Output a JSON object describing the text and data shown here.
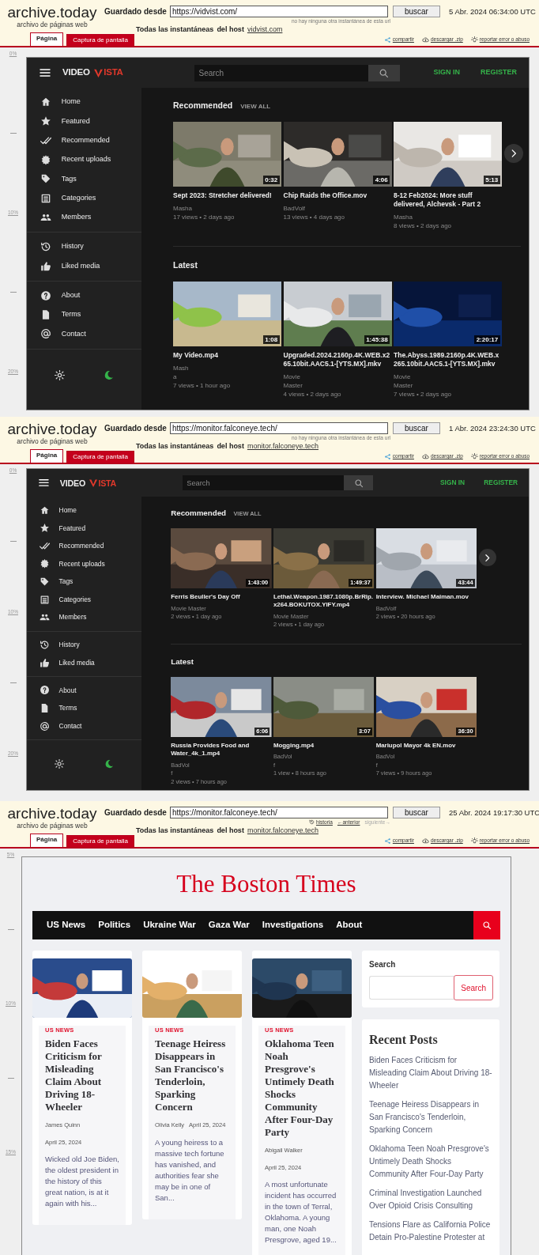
{
  "snapshots": [
    {
      "archive": {
        "logo": "archive.today",
        "tagline": "archivo de páginas web",
        "saved_from_label": "Guardado desde",
        "url": "https://vidvist.com/",
        "search_button": "buscar",
        "date": "5 Abr. 2024 06:34:00 UTC",
        "note": "no hay ninguna otra instantánea de esta url",
        "all_snapshots_label": "Todas las instantáneas",
        "host_label": "del host",
        "host": "vidvist.com",
        "tabs": [
          {
            "label": "Página",
            "selected": true
          },
          {
            "label": "Captura de pantalla",
            "selected": false
          }
        ],
        "actions": [
          {
            "kind": "share",
            "label": "compartir"
          },
          {
            "kind": "download",
            "label": "descargar .zip"
          },
          {
            "kind": "report",
            "label": "reportar error o abuso"
          }
        ],
        "ruler": [
          "0%",
          "10%",
          "20%"
        ]
      },
      "site": {
        "kind": "video",
        "logo": {
          "text": "VIDEO",
          "accent": "ISTA"
        },
        "search_placeholder": "Search",
        "auth": [
          "SIGN IN",
          "REGISTER"
        ],
        "nav_groups": [
          [
            "Home",
            "Featured",
            "Recommended",
            "Recent uploads",
            "Tags",
            "Categories",
            "Members"
          ],
          [
            "History",
            "Liked media"
          ],
          [
            "About",
            "Terms",
            "Contact"
          ]
        ],
        "theme_options": [
          {
            "kind": "light",
            "selected": false
          },
          {
            "kind": "dark",
            "selected": true
          }
        ],
        "sections": [
          {
            "title": "Recommended",
            "link": "VIEW ALL",
            "videos": [
              {
                "duration": "0:32",
                "title": "Sept 2023: Stretcher delivered!",
                "author_lines": [
                  "Masha"
                ],
                "meta": "17 views • 2 days ago"
              },
              {
                "duration": "4:06",
                "title": "Chip Raids the Office.mov",
                "author_lines": [
                  "BadVolf"
                ],
                "meta": "13 views • 4 days ago"
              },
              {
                "duration": "5:13",
                "title": "8-12 Feb2024: More stuff delivered, Alchevsk - Part 2",
                "author_lines": [
                  "Masha"
                ],
                "meta": "8 views • 2 days ago"
              }
            ]
          },
          {
            "title": "Latest",
            "videos": [
              {
                "duration": "1:08",
                "title": "My Video.mp4",
                "author_lines": [
                  "Mash",
                  "a"
                ],
                "meta": "7 views • 1 hour ago"
              },
              {
                "duration": "1:45:38",
                "title": "Upgraded.2024.2160p.4K.WEB.x265.10bit.AAC5.1-[YTS.MX].mkv",
                "author_lines": [
                  "Movie",
                  "Master"
                ],
                "meta": "4 views • 2 days ago"
              },
              {
                "duration": "2:20:17",
                "title": "The.Abyss.1989.2160p.4K.WEB.x265.10bit.AAC5.1-[YTS.MX].mkv",
                "author_lines": [
                  "Movie",
                  "Master"
                ],
                "meta": "7 views • 2 days ago"
              }
            ]
          }
        ]
      }
    },
    {
      "archive": {
        "logo": "archive.today",
        "tagline": "archivo de páginas web",
        "saved_from_label": "Guardado desde",
        "url": "https://monitor.falconeye.tech/",
        "search_button": "buscar",
        "date": "1 Abr. 2024 23:24:30 UTC",
        "note": "no hay ninguna otra instantánea de esta url",
        "all_snapshots_label": "Todas las instantáneas",
        "host_label": "del host",
        "host": "monitor.falconeye.tech",
        "tabs": [
          {
            "label": "Página",
            "selected": true
          },
          {
            "label": "Captura de pantalla",
            "selected": false
          }
        ],
        "actions": [
          {
            "kind": "share",
            "label": "compartir"
          },
          {
            "kind": "download",
            "label": "descargar .zip"
          },
          {
            "kind": "report",
            "label": "reportar error o abuso"
          }
        ],
        "ruler": [
          "0%",
          "10%",
          "20%"
        ]
      },
      "site": {
        "kind": "video",
        "logo": {
          "text": "VIDEO",
          "accent": "ISTA"
        },
        "search_placeholder": "Search",
        "auth": [
          "SIGN IN",
          "REGISTER"
        ],
        "nav_groups": [
          [
            "Home",
            "Featured",
            "Recommended",
            "Recent uploads",
            "Tags",
            "Categories",
            "Members"
          ],
          [
            "History",
            "Liked media"
          ],
          [
            "About",
            "Terms",
            "Contact"
          ]
        ],
        "theme_options": [
          {
            "kind": "light",
            "selected": false
          },
          {
            "kind": "dark",
            "selected": true
          }
        ],
        "sections": [
          {
            "title": "Recommended",
            "link": "VIEW ALL",
            "videos": [
              {
                "duration": "1:43:00",
                "title": "Ferris Beuller's Day Off",
                "author_lines": [
                  "Movie Master"
                ],
                "meta": "2 views • 1 day ago"
              },
              {
                "duration": "1:49:37",
                "title": "Lethal.Weapon.1987.1080p.BrRip.x264.BOKUTOX.YIFY.mp4",
                "author_lines": [
                  "Movie Master"
                ],
                "meta": "2 views • 1 day ago"
              },
              {
                "duration": "43:44",
                "title": "Interview. Michael Maiman.mov",
                "author_lines": [
                  "BadVolf"
                ],
                "meta": "2 views • 20 hours ago"
              }
            ]
          },
          {
            "title": "Latest",
            "videos": [
              {
                "duration": "6:06",
                "title": "Russia Provides Food and Water_4k_1.mp4",
                "author_lines": [
                  "BadVol",
                  "f"
                ],
                "meta": "2 views • 7 hours ago"
              },
              {
                "duration": "3:07",
                "title": "Mogging.mp4",
                "author_lines": [
                  "BadVol",
                  "f"
                ],
                "meta": "1 view • 8 hours ago"
              },
              {
                "duration": "36:30",
                "title": "Mariupol Mayor 4k EN.mov",
                "author_lines": [
                  "BadVol",
                  "f"
                ],
                "meta": "7 views • 9 hours ago"
              }
            ]
          }
        ]
      }
    },
    {
      "archive": {
        "logo": "archive.today",
        "tagline": "archivo de páginas web",
        "saved_from_label": "Guardado desde",
        "url": "https://monitor.falconeye.tech/",
        "search_button": "buscar",
        "date": "25 Abr. 2024 19:17:30 UTC",
        "history_links": [
          {
            "kind": "history",
            "label": "historia",
            "disabled": false
          },
          {
            "kind": "link",
            "label": "←anterior",
            "disabled": false
          },
          {
            "kind": "link",
            "label": "siguiente→",
            "disabled": true
          }
        ],
        "all_snapshots_label": "Todas las instantáneas",
        "host_label": "del host",
        "host": "monitor.falconeye.tech",
        "tabs": [
          {
            "label": "Página",
            "selected": true
          },
          {
            "label": "Captura de pantalla",
            "selected": false
          }
        ],
        "actions": [
          {
            "kind": "share",
            "label": "compartir"
          },
          {
            "kind": "download",
            "label": "descargar .zip"
          },
          {
            "kind": "report",
            "label": "reportar error o abuso"
          }
        ],
        "ruler": [
          "5%",
          "10%",
          "15%"
        ]
      },
      "site": {
        "kind": "blog",
        "title": "The Boston Times",
        "nav": [
          "US News",
          "Politics",
          "Ukraine War",
          "Gaza War",
          "Investigations",
          "About"
        ],
        "posts": [
          {
            "category": "US NEWS",
            "title": "Biden Faces Criticism for Misleading Claim About Driving 18-Wheeler",
            "author": "James Quinn",
            "date": "April 25, 2024",
            "excerpt": "Wicked old Joe Biden, the oldest president in the history of this great nation, is at it again with his..."
          },
          {
            "category": "US NEWS",
            "title": "Teenage Heiress Disappears in San Francisco's Tenderloin, Sparking Concern",
            "author": "Olivia Kelly",
            "date": "April 25, 2024",
            "excerpt": "A young heiress to a massive tech fortune has vanished, and authorities fear she may be in one of San..."
          },
          {
            "category": "US NEWS",
            "title": "Oklahoma Teen Noah Presgrove's Untimely Death Shocks Community After Four-Day Party",
            "author": "Abigail Walker",
            "date": "April 25, 2024",
            "excerpt": "A most unfortunate incident has occurred in the town of Terral, Oklahoma. A young man, one Noah Presgrove, aged 19..."
          }
        ],
        "search_widget": {
          "title": "Search",
          "button": "Search"
        },
        "recent_posts": {
          "title": "Recent Posts",
          "items": [
            "Biden Faces Criticism for Misleading Claim About Driving 18-Wheeler",
            "Teenage Heiress Disappears in San Francisco's Tenderloin, Sparking Concern",
            "Oklahoma Teen Noah Presgrove's Untimely Death Shocks Community After Four-Day Party",
            "Criminal Investigation Launched Over Opioid Crisis Consulting",
            "Tensions Flare as California Police Detain Pro-Palestine Protester at"
          ]
        }
      }
    }
  ]
}
